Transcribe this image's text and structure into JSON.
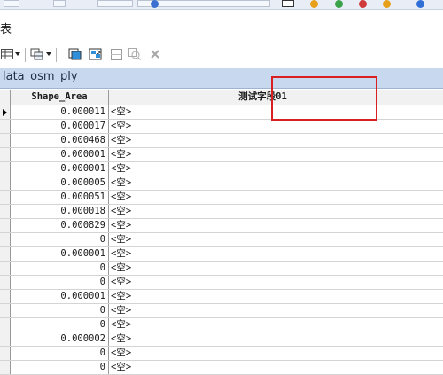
{
  "window": {
    "title": "表"
  },
  "layer": {
    "tab_label": "lata_osm_ply"
  },
  "table": {
    "columns": [
      "Shape_Area",
      "测试字段01"
    ],
    "rows": [
      {
        "area": "0.000011",
        "test": "<空>"
      },
      {
        "area": "0.000017",
        "test": "<空>"
      },
      {
        "area": "0.000468",
        "test": "<空>"
      },
      {
        "area": "0.000001",
        "test": "<空>"
      },
      {
        "area": "0.000001",
        "test": "<空>"
      },
      {
        "area": "0.000005",
        "test": "<空>"
      },
      {
        "area": "0.000051",
        "test": "<空>"
      },
      {
        "area": "0.000018",
        "test": "<空>"
      },
      {
        "area": "0.000829",
        "test": "<空>"
      },
      {
        "area": "0",
        "test": "<空>"
      },
      {
        "area": "0.000001",
        "test": "<空>"
      },
      {
        "area": "0",
        "test": "<空>"
      },
      {
        "area": "0",
        "test": "<空>"
      },
      {
        "area": "0.000001",
        "test": "<空>"
      },
      {
        "area": "0",
        "test": "<空>"
      },
      {
        "area": "0",
        "test": "<空>"
      },
      {
        "area": "0.000002",
        "test": "<空>"
      },
      {
        "area": "0",
        "test": "<空>"
      },
      {
        "area": "0",
        "test": "<空>"
      }
    ]
  },
  "colors": {
    "highlight": "#d92020",
    "tab_bg": "#c8d9ef"
  },
  "icons": [
    "table-options-icon",
    "dropdown-arrow-icon",
    "related-tables-icon",
    "select-by-attributes-icon",
    "switch-selection-icon",
    "clear-selection-icon",
    "zoom-to-selected-icon",
    "delete-selected-icon",
    "current-row-arrow-icon"
  ]
}
